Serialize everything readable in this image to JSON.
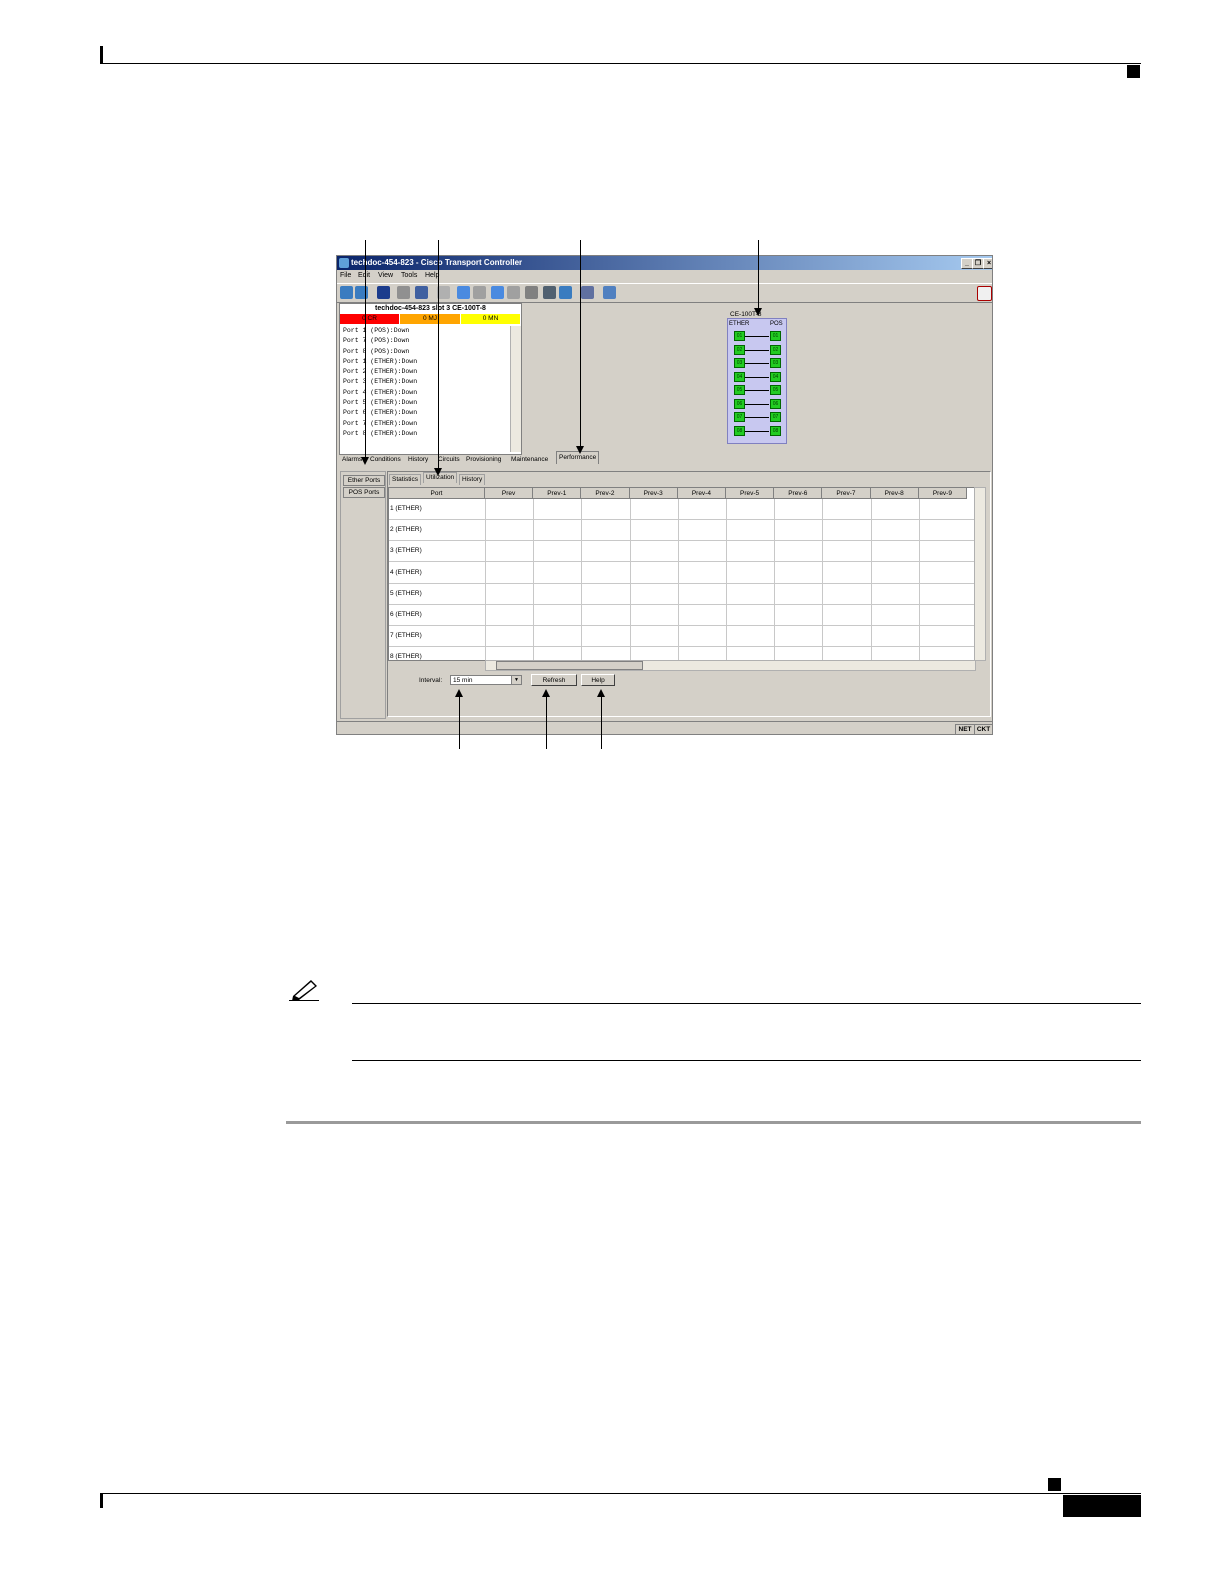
{
  "window": {
    "title": "techdoc-454-823 - Cisco Transport Controller",
    "controls": [
      "_",
      "❐",
      "×"
    ]
  },
  "menu": [
    "File",
    "Edit",
    "View",
    "Tools",
    "Help"
  ],
  "toolbar_icons": [
    "globe-icon",
    "globe-icon",
    "lock-icon",
    "printer-icon",
    "export-icon",
    "zoom-icon",
    "back-arrow-icon",
    "forward-arrow-icon",
    "up-arrow-icon",
    "down-arrow-icon",
    "node-icon",
    "network-icon",
    "globe-icon",
    "window-icon",
    "graph-icon",
    "help-icon"
  ],
  "card": {
    "title": "techdoc-454-823 slot 3 CE-100T-8",
    "alarms": [
      {
        "label": "0 CR",
        "color": "#ff0000"
      },
      {
        "label": "0 MJ",
        "color": "#ffa500"
      },
      {
        "label": "0 MN",
        "color": "#ffff00"
      }
    ],
    "ports": [
      "Port 1 (POS):Down",
      "Port 7 (POS):Down",
      "Port 8 (POS):Down",
      "Port 1 (ETHER):Down",
      "Port 2 (ETHER):Down",
      "Port 3 (ETHER):Down",
      "Port 4 (ETHER):Down",
      "Port 5 (ETHER):Down",
      "Port 6 (ETHER):Down",
      "Port 7 (ETHER):Down",
      "Port 8 (ETHER):Down"
    ]
  },
  "diagram": {
    "label": "CE-100T-8",
    "left_header": "ETHER",
    "right_header": "POS",
    "ports": [
      "01",
      "02",
      "03",
      "04",
      "05",
      "06",
      "07",
      "08"
    ]
  },
  "tabs": [
    "Alarms",
    "Conditions",
    "History",
    "Circuits",
    "Provisioning",
    "Maintenance",
    "Performance"
  ],
  "side_buttons": [
    "Ether Ports",
    "POS Ports"
  ],
  "subtabs": [
    "Statistics",
    "Utilization",
    "History"
  ],
  "table": {
    "columns": [
      "Port",
      "Prev",
      "Prev-1",
      "Prev-2",
      "Prev-3",
      "Prev-4",
      "Prev-5",
      "Prev-6",
      "Prev-7",
      "Prev-8",
      "Prev-9"
    ],
    "rows": [
      "1 (ETHER)",
      "2 (ETHER)",
      "3 (ETHER)",
      "4 (ETHER)",
      "5 (ETHER)",
      "6 (ETHER)",
      "7 (ETHER)",
      "8 (ETHER)"
    ]
  },
  "controls": {
    "interval_label": "Interval:",
    "interval_value": "15 min",
    "refresh": "Refresh",
    "help": "Help"
  },
  "status": [
    "NET",
    "CKT"
  ]
}
